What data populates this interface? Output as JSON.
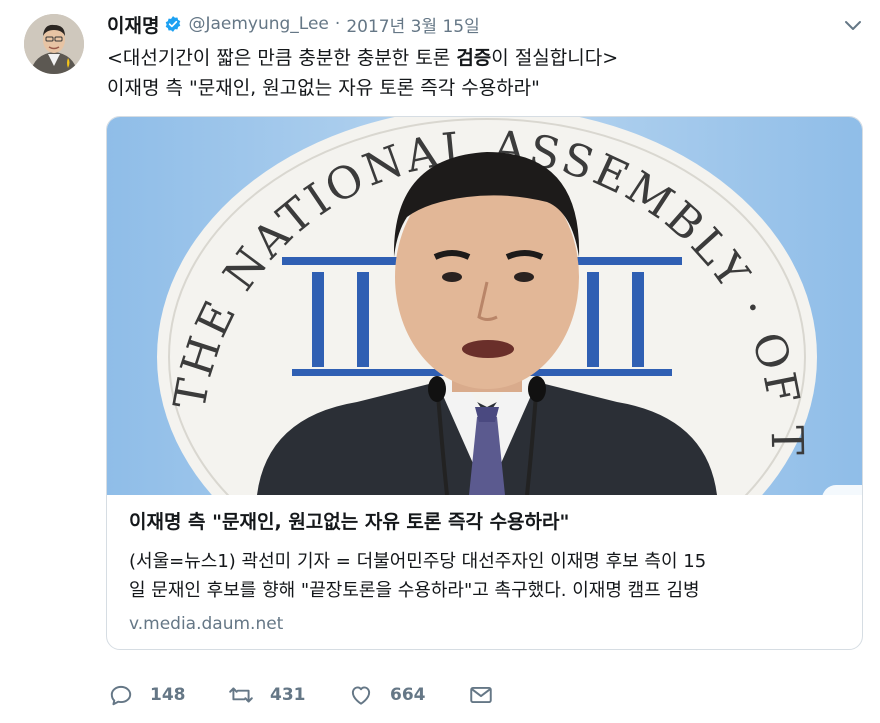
{
  "tweet": {
    "author_name": "이재명",
    "handle": "@Jaemyung_Lee",
    "separator": "·",
    "date": "2017년 3월 15일",
    "text_line1_before": "<대선기간이 짧은 만큼 충분한 충분한 토론 ",
    "text_line1_bold": "검증",
    "text_line1_after": "이 절실합니다>",
    "text_line2": "이재명 측 \"문재인, 원고없는 자유 토론 즉각 수용하라\""
  },
  "card": {
    "title": "이재명 측 \"문재인, 원고없는 자유 토론 즉각 수용하라\"",
    "desc_line1": "(서울=뉴스1) 곽선미 기자 = 더불어민주당 대선주자인 이재명 후보 측이 15",
    "desc_line2": "일 문재인 후보를 향해 \"끝장토론을 수용하라\"고 촉구했다. 이재명 캠프 김병",
    "domain": "v.media.daum.net",
    "emblem_text_left": "THE NATIONAL ASSEMBLY",
    "emblem_text_right": "OF THE REPUBLIC OF KOREA"
  },
  "actions": {
    "reply_count": "148",
    "retweet_count": "431",
    "like_count": "664"
  },
  "icons": {
    "verified": "verified-badge-icon",
    "caret": "chevron-down-icon",
    "reply": "reply-icon",
    "retweet": "retweet-icon",
    "like": "heart-icon",
    "message": "envelope-icon"
  },
  "colors": {
    "accent": "#1da1f2",
    "text": "#14171a",
    "muted": "#657786",
    "border": "#d6dde3",
    "emblem_blue": "#2f5fb3"
  }
}
